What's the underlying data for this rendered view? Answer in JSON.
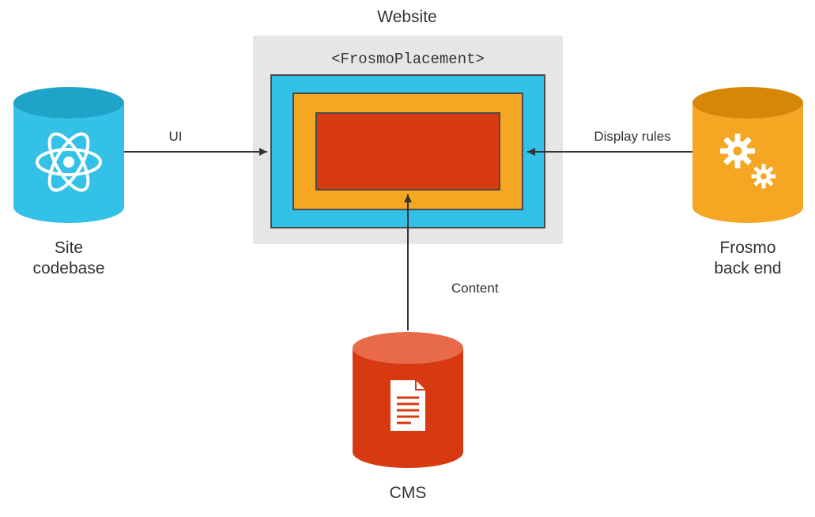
{
  "title": "Website",
  "placement_tag": "<FrosmoPlacement>",
  "nodes": {
    "site_codebase": {
      "label_line1": "Site",
      "label_line2": "codebase"
    },
    "frosmo_backend": {
      "label_line1": "Frosmo",
      "label_line2": "back end"
    },
    "cms": {
      "label": "CMS"
    }
  },
  "edges": {
    "ui": {
      "label": "UI"
    },
    "display_rules": {
      "label": "Display rules"
    },
    "content": {
      "label": "Content"
    }
  },
  "colors": {
    "cyan": "#33c1e8",
    "cyan_dark": "#1ea4c9",
    "orange": "#f5a623",
    "orange_dark": "#d48806",
    "red": "#d73a11",
    "red_dark": "#b62f0b",
    "grey_box": "#e6e6e6",
    "stroke_grey": "#4a4a4a",
    "arrow": "#333333",
    "text": "#333333"
  }
}
